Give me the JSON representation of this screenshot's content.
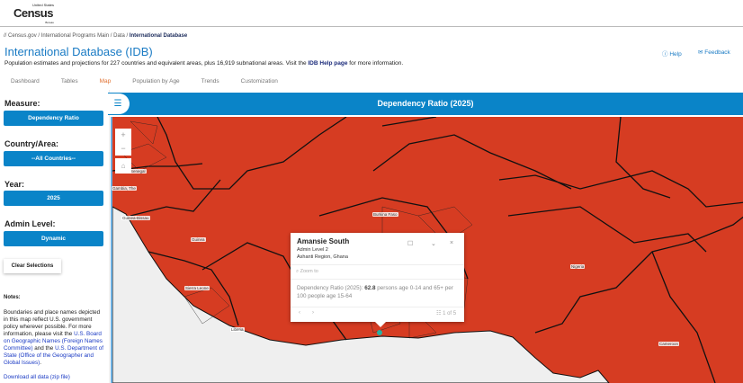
{
  "logo": {
    "small": "United States",
    "main": "Census",
    "bureau": "Bureau"
  },
  "breadcrumb": [
    "Census.gov",
    "International Programs Main",
    "Data",
    "International Database"
  ],
  "title": "International Database (IDB)",
  "subtitle": {
    "pre": "Population estimates and projections for 227 countries and equivalent areas, plus 16,919 subnational areas. Visit the ",
    "link": "IDB Help page",
    "post": " for more information."
  },
  "header_links": {
    "help": "Help",
    "feedback": "Feedback"
  },
  "tabs": [
    "Dashboard",
    "Tables",
    "Map",
    "Population by Age",
    "Trends",
    "Customization"
  ],
  "sidebar": {
    "measure_label": "Measure:",
    "measure": "Dependency Ratio",
    "country_label": "Country/Area:",
    "country": "--All Countries--",
    "year_label": "Year:",
    "year": "2025",
    "admin_label": "Admin Level:",
    "admin": "Dynamic",
    "clear": "Clear Selections",
    "notes_label": "Notes:",
    "notes_text": "Boundaries and place names depicted in this map reflect U.S. government policy wherever possible. For more information, please visit the ",
    "link1": "U.S. Board on Geographic Names (Foreign Names Committee)",
    "mid": " and the ",
    "link2": "U.S. Department of State (Office of the Geographer and Global Issues)",
    "end": ".",
    "download": "Download all data (zip file)"
  },
  "map": {
    "title": "Dependency Ratio (2025)",
    "fill_color": "#d63c22",
    "ocean_color": "#f0f0f0",
    "labels": [
      "Senegal",
      "Gambia, The",
      "Guinea-Bissau",
      "Guinea",
      "Sierra Leone",
      "Liberia",
      "Burkina Faso",
      "Nigeria",
      "Cameroon"
    ]
  },
  "popup": {
    "name": "Amansie South",
    "level": "Admin Level 2",
    "region": "Ashanti Region, Ghana",
    "zoom_to": "Zoom to",
    "label": "Dependency Ratio (2025): ",
    "value": "62.8",
    "desc": " persons age 0-14 and 65+ per 100 people age 15-64",
    "pager": "1 of 5"
  }
}
